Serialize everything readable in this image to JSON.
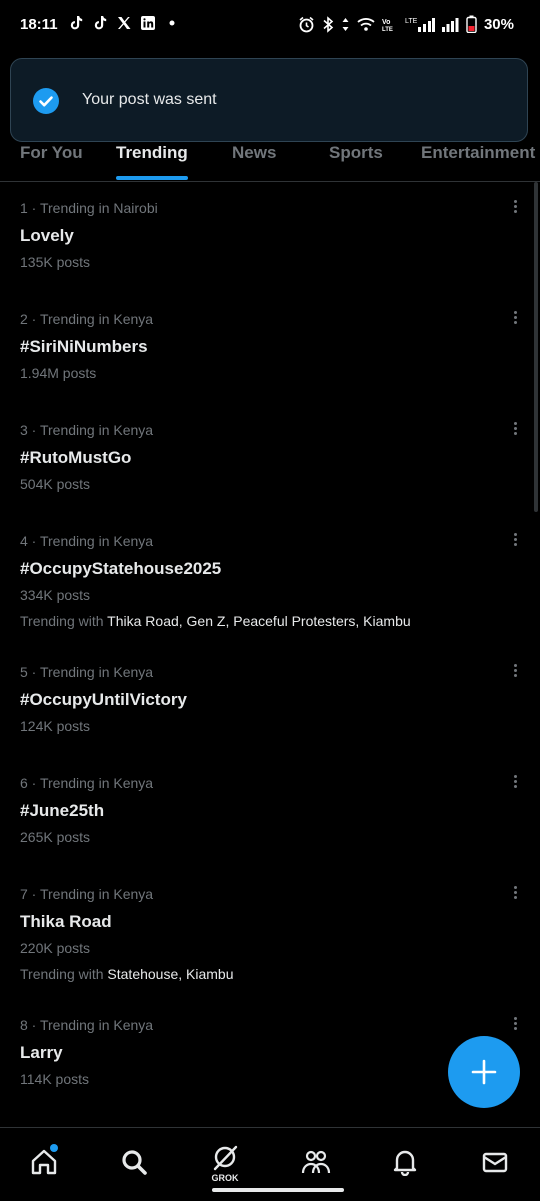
{
  "status_bar": {
    "time": "18:11",
    "battery": "30%",
    "left_icons": [
      "tiktok-icon",
      "tiktok-icon",
      "x-icon",
      "linkedin-icon",
      "dot-icon"
    ],
    "right_icons": [
      "alarm-icon",
      "bluetooth-icon",
      "data-arrows-icon",
      "wifi-icon",
      "volte-icon",
      "lte-signal-icon",
      "signal-icon",
      "battery-icon"
    ]
  },
  "toast": {
    "text": "Your post was sent"
  },
  "tabs": [
    {
      "label": "For You"
    },
    {
      "label": "Trending"
    },
    {
      "label": "News"
    },
    {
      "label": "Sports"
    },
    {
      "label": "Entertainment"
    }
  ],
  "trends": [
    {
      "meta": "1 · Trending in Nairobi",
      "name": "Lovely",
      "posts": "135K posts"
    },
    {
      "meta": "2 · Trending in Kenya",
      "name": "#SiriNiNumbers",
      "posts": "1.94M posts"
    },
    {
      "meta": "3 · Trending in Kenya",
      "name": "#RutoMustGo",
      "posts": "504K posts"
    },
    {
      "meta": "4 · Trending in Kenya",
      "name": "#OccupyStatehouse2025",
      "posts": "334K posts",
      "with_label": "Trending with ",
      "with_names": "Thika Road, Gen Z, Peaceful Protesters, Kiambu"
    },
    {
      "meta": "5 · Trending in Kenya",
      "name": "#OccupyUntilVictory",
      "posts": "124K posts"
    },
    {
      "meta": "6 · Trending in Kenya",
      "name": "#June25th",
      "posts": "265K posts"
    },
    {
      "meta": "7 · Trending in Kenya",
      "name": "Thika Road",
      "posts": "220K posts",
      "with_label": "Trending with ",
      "with_names": "Statehouse, Kiambu"
    },
    {
      "meta": "8 · Trending in Kenya",
      "name": "Larry",
      "posts": "114K posts"
    }
  ],
  "bottom_nav": {
    "items": [
      "home-icon",
      "search-icon",
      "grok-icon",
      "communities-icon",
      "notifications-icon",
      "messages-icon"
    ],
    "grok_label": "GROK"
  },
  "colors": {
    "accent": "#1d9bf0",
    "background": "#000000",
    "muted": "#71767b",
    "text": "#e7e9ea"
  }
}
